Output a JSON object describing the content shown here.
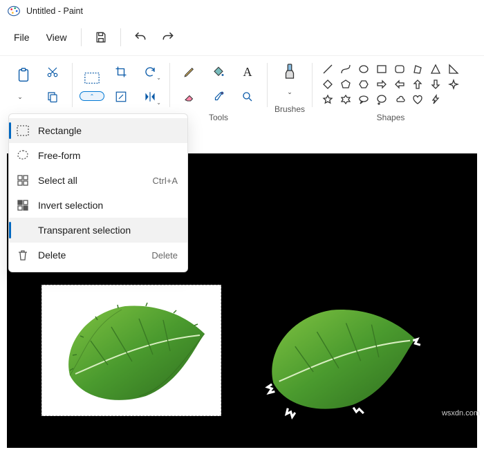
{
  "window": {
    "title": "Untitled - Paint"
  },
  "menubar": {
    "file": "File",
    "view": "View"
  },
  "ribbon": {
    "tools_label": "Tools",
    "brushes_label": "Brushes",
    "shapes_label": "Shapes"
  },
  "dropdown": {
    "rectangle": "Rectangle",
    "freeform": "Free-form",
    "select_all": "Select all",
    "select_all_shortcut": "Ctrl+A",
    "invert": "Invert selection",
    "transparent": "Transparent selection",
    "delete": "Delete",
    "delete_shortcut": "Delete"
  },
  "watermark": "wsxdn.com"
}
